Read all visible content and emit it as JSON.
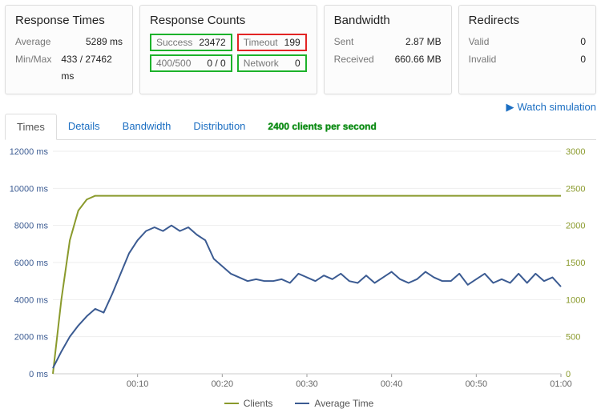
{
  "cards": {
    "response_times": {
      "title": "Response Times",
      "avg_label": "Average",
      "avg_value": "5289 ms",
      "minmax_label": "Min/Max",
      "minmax_value": "433 / 27462 ms"
    },
    "response_counts": {
      "title": "Response Counts",
      "success_label": "Success",
      "success_value": "23472",
      "timeout_label": "Timeout",
      "timeout_value": "199",
      "err_label": "400/500",
      "err_value": "0 / 0",
      "network_label": "Network",
      "network_value": "0"
    },
    "bandwidth": {
      "title": "Bandwidth",
      "sent_label": "Sent",
      "sent_value": "2.87 MB",
      "recv_label": "Received",
      "recv_value": "660.66 MB"
    },
    "redirects": {
      "title": "Redirects",
      "valid_label": "Valid",
      "valid_value": "0",
      "invalid_label": "Invalid",
      "invalid_value": "0"
    }
  },
  "watch": "Watch simulation",
  "tabs": {
    "times": "Times",
    "details": "Details",
    "bandwidth": "Bandwidth",
    "distribution": "Distribution"
  },
  "annotation": "2400 clients per second",
  "legend": {
    "clients": "Clients",
    "avg_time": "Average Time"
  },
  "colors": {
    "clients_line": "#8a9a2c",
    "avgtime_line": "#3b5b92",
    "left_axis": "#3b5b92",
    "right_axis": "#8a9a2c"
  },
  "chart_data": {
    "type": "line",
    "title": "Times",
    "xlabel": "",
    "ylabel_left": "ms",
    "ylabel_right": "clients",
    "xlim": [
      0,
      60
    ],
    "ylim_left": [
      0,
      12000
    ],
    "ylim_right": [
      0,
      3000
    ],
    "x_ticks": [
      "00:10",
      "00:20",
      "00:30",
      "00:40",
      "00:50",
      "01:00"
    ],
    "y_ticks_left": [
      "0 ms",
      "2000 ms",
      "4000 ms",
      "6000 ms",
      "8000 ms",
      "10000 ms",
      "12000 ms"
    ],
    "y_ticks_right": [
      "0",
      "500",
      "1000",
      "1500",
      "2000",
      "2500",
      "3000"
    ],
    "x_seconds": [
      0,
      1,
      2,
      3,
      4,
      5,
      6,
      7,
      8,
      9,
      10,
      11,
      12,
      13,
      14,
      15,
      16,
      17,
      18,
      19,
      20,
      21,
      22,
      23,
      24,
      25,
      26,
      27,
      28,
      29,
      30,
      31,
      32,
      33,
      34,
      35,
      36,
      37,
      38,
      39,
      40,
      41,
      42,
      43,
      44,
      45,
      46,
      47,
      48,
      49,
      50,
      51,
      52,
      53,
      54,
      55,
      56,
      57,
      58,
      59,
      60
    ],
    "series": [
      {
        "name": "Clients",
        "axis": "right",
        "values": [
          0,
          1000,
          1800,
          2200,
          2350,
          2400,
          2400,
          2400,
          2400,
          2400,
          2400,
          2400,
          2400,
          2400,
          2400,
          2400,
          2400,
          2400,
          2400,
          2400,
          2400,
          2400,
          2400,
          2400,
          2400,
          2400,
          2400,
          2400,
          2400,
          2400,
          2400,
          2400,
          2400,
          2400,
          2400,
          2400,
          2400,
          2400,
          2400,
          2400,
          2400,
          2400,
          2400,
          2400,
          2400,
          2400,
          2400,
          2400,
          2400,
          2400,
          2400,
          2400,
          2400,
          2400,
          2400,
          2400,
          2400,
          2400,
          2400,
          2400,
          2400
        ]
      },
      {
        "name": "Average Time",
        "axis": "left",
        "values": [
          300,
          1200,
          2000,
          2600,
          3100,
          3500,
          3300,
          4300,
          5400,
          6500,
          7200,
          7700,
          7900,
          7700,
          8000,
          7700,
          7900,
          7500,
          7200,
          6200,
          5800,
          5400,
          5200,
          5000,
          5100,
          5000,
          5000,
          5100,
          4900,
          5400,
          5200,
          5000,
          5300,
          5100,
          5400,
          5000,
          4900,
          5300,
          4900,
          5200,
          5500,
          5100,
          4900,
          5100,
          5500,
          5200,
          5000,
          5000,
          5400,
          4800,
          5100,
          5400,
          4900,
          5100,
          4900,
          5400,
          4900,
          5400,
          5000,
          5200,
          4700
        ]
      }
    ]
  }
}
